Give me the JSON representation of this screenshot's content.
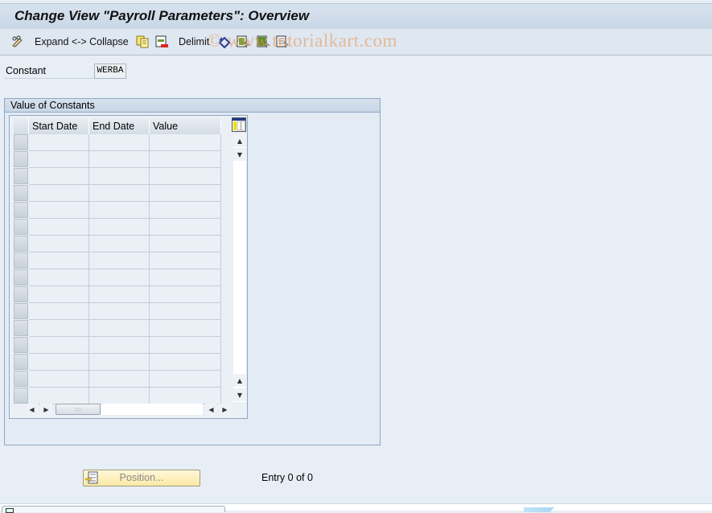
{
  "window": {
    "title": "Change View \"Payroll Parameters\": Overview"
  },
  "toolbar": {
    "items": [
      {
        "icon": "edit-glasses-icon",
        "label": ""
      },
      {
        "icon": "",
        "label": "Expand <-> Collapse"
      },
      {
        "icon": "copy-icon",
        "label": ""
      },
      {
        "icon": "delete-icon",
        "label": ""
      },
      {
        "icon": "",
        "label": "Delimit"
      },
      {
        "icon": "undo-change-icon",
        "label": ""
      },
      {
        "icon": "select-all-icon",
        "label": ""
      },
      {
        "icon": "select-block-icon",
        "label": ""
      },
      {
        "icon": "deselect-all-icon",
        "label": ""
      }
    ]
  },
  "watermark": "© www.tutorialkart.com",
  "constant": {
    "label": "Constant",
    "value": "WERBA"
  },
  "group": {
    "title": "Value of Constants",
    "columns": [
      "Start Date",
      "End Date",
      "Value"
    ],
    "rows": [
      [
        "",
        "",
        ""
      ],
      [
        "",
        "",
        ""
      ],
      [
        "",
        "",
        ""
      ],
      [
        "",
        "",
        ""
      ],
      [
        "",
        "",
        ""
      ],
      [
        "",
        "",
        ""
      ],
      [
        "",
        "",
        ""
      ],
      [
        "",
        "",
        ""
      ],
      [
        "",
        "",
        ""
      ],
      [
        "",
        "",
        ""
      ],
      [
        "",
        "",
        ""
      ],
      [
        "",
        "",
        ""
      ],
      [
        "",
        "",
        ""
      ],
      [
        "",
        "",
        ""
      ],
      [
        "",
        "",
        ""
      ],
      [
        "",
        "",
        ""
      ]
    ]
  },
  "footer": {
    "position_button": "Position...",
    "entry_text": "Entry 0 of 0"
  },
  "colors": {
    "accent": "#8fa9c6",
    "button": "#fbe9a6"
  }
}
